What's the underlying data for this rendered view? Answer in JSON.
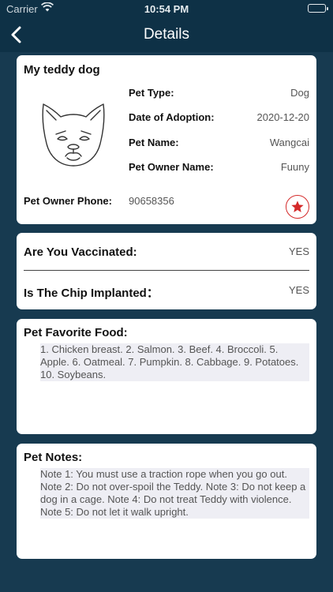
{
  "status_bar": {
    "carrier": "Carrier",
    "time": "10:54 PM"
  },
  "nav": {
    "title": "Details"
  },
  "pet_card": {
    "title": "My teddy dog",
    "rows": [
      {
        "label": "Pet Type:",
        "value": "Dog"
      },
      {
        "label": "Date of Adoption:",
        "value": "2020-12-20"
      },
      {
        "label": "Pet Name:",
        "value": "Wangcai"
      },
      {
        "label": "Pet Owner Name:",
        "value": "Fuuny"
      }
    ],
    "phone_label": "Pet Owner Phone:",
    "phone_value": "90658356"
  },
  "health_card": {
    "vaccinated_label": "Are You Vaccinated:",
    "vaccinated_value": "YES",
    "chip_label": "Is The Chip Implanted：",
    "chip_value": "YES"
  },
  "food_card": {
    "title": "Pet Favorite Food:",
    "text": "1. Chicken breast. 2. Salmon. 3. Beef. 4. Broccoli. 5. Apple. 6. Oatmeal. 7. Pumpkin. 8. Cabbage. 9. Potatoes. 10. Soybeans."
  },
  "notes_card": {
    "title": "Pet Notes:",
    "text": "Note 1: You must use a traction rope when you go out. Note 2: Do not over-spoil the Teddy. Note 3: Do not keep a dog in a cage. Note 4: Do not treat Teddy with violence. Note 5: Do not let it walk upright."
  },
  "colors": {
    "background": "#173a50",
    "nav_bar": "#0e3146",
    "favorite_accent": "#d42a2a",
    "text_box": "#eeeef4"
  },
  "icons": {
    "back": "chevron-left-icon",
    "wifi": "wifi-icon",
    "battery": "battery-icon",
    "pet": "dog-face-icon",
    "favorite": "star-icon"
  }
}
